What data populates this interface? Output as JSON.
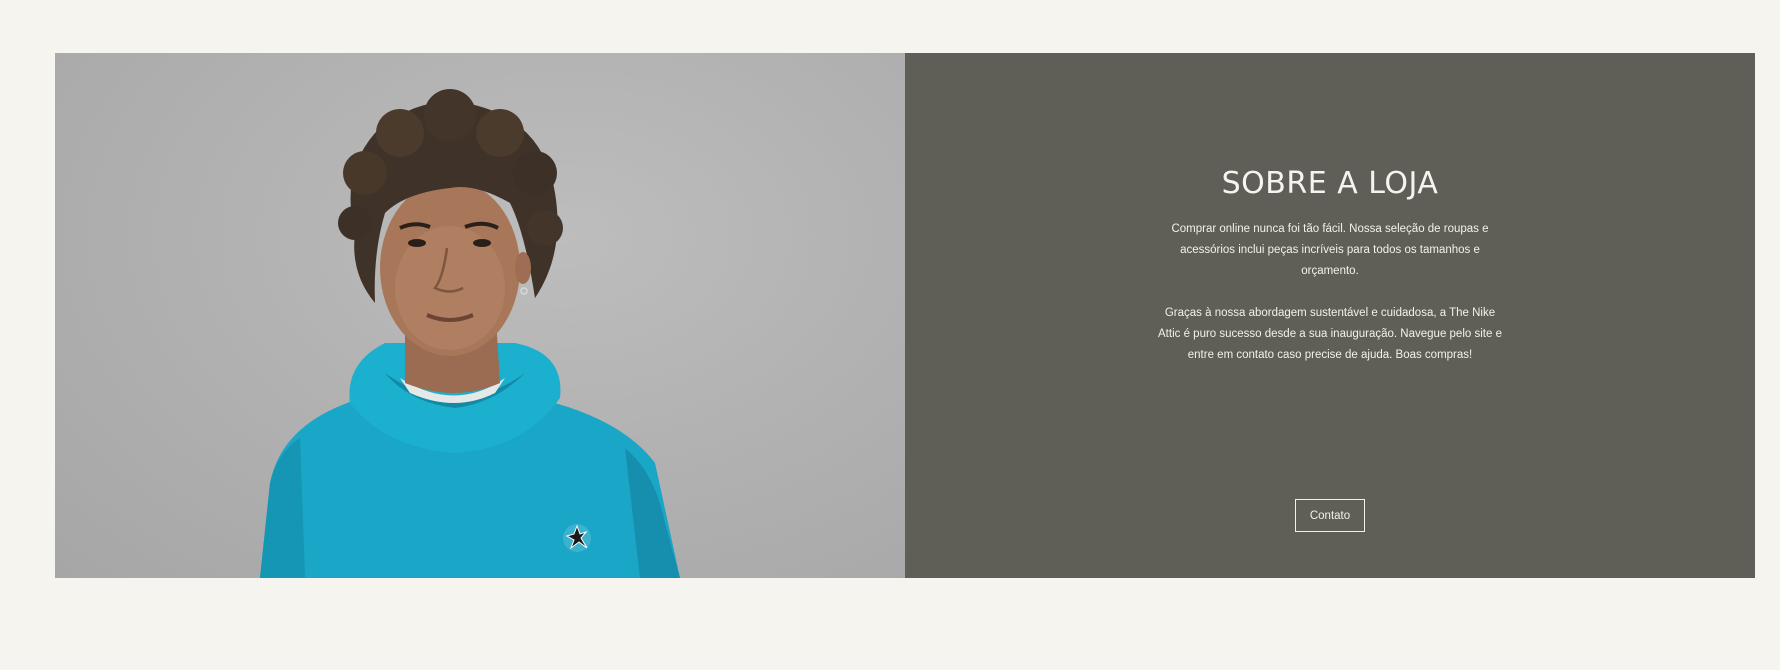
{
  "about": {
    "title": "SOBRE A LOJA",
    "paragraph_1": "Comprar online nunca foi tão fácil. Nossa seleção de roupas e acessórios inclui peças incríveis para todos os tamanhos e orçamento.",
    "paragraph_2": "Graças à nossa abordagem sustentável e cuidadosa, a The Nike Attic é puro sucesso desde a sua inauguração. Navegue pelo site e entre em contato caso precise de ajuda. Boas compras!",
    "contact_label": "Contato"
  },
  "colors": {
    "page_background": "#f6f4ee",
    "panel_background": "#5f5f57",
    "text": "#f3f1ea",
    "hoodie": "#1aa6c6"
  },
  "image": {
    "subject": "model-in-teal-hoodie"
  }
}
